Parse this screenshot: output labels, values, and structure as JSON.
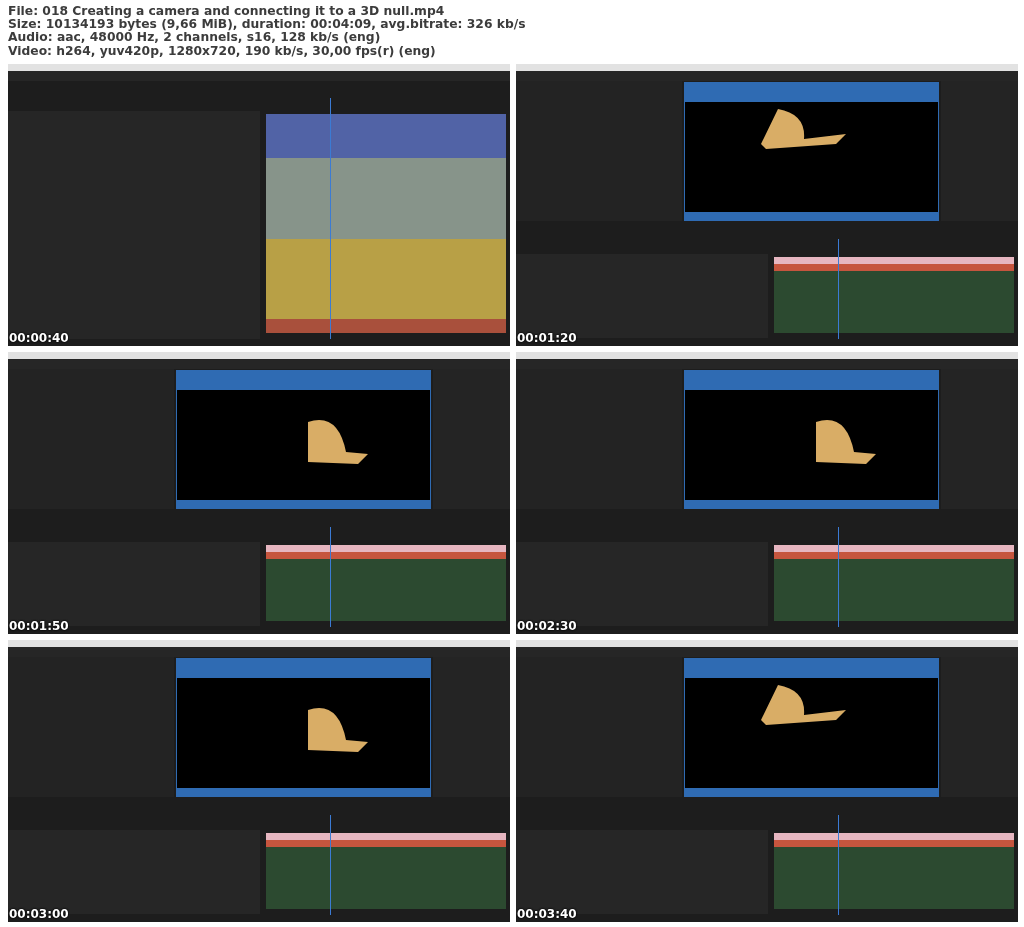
{
  "file_info": [
    "File: 018 Creating a camera and connecting it to a 3D null.mp4",
    "Size: 10134193 bytes (9,66 MiB), duration: 00:04:09, avg.bitrate: 326 kb/s",
    "Audio: aac, 48000 Hz, 2 channels, s16, 128 kb/s (eng)",
    "Video: h264, yuv420p, 1280x720, 190 kb/s, 30,00 fps(r) (eng)"
  ],
  "frames": [
    {
      "kind": "picture",
      "timestamp": "00:00:40"
    },
    {
      "kind": "picture",
      "timestamp": "00:01:20"
    },
    {
      "kind": "picture",
      "timestamp": "00:01:50"
    },
    {
      "kind": "picture",
      "timestamp": "00:02:30"
    },
    {
      "kind": "picture",
      "timestamp": "00:03:00"
    },
    {
      "kind": "picture",
      "timestamp": "00:03:40"
    }
  ]
}
